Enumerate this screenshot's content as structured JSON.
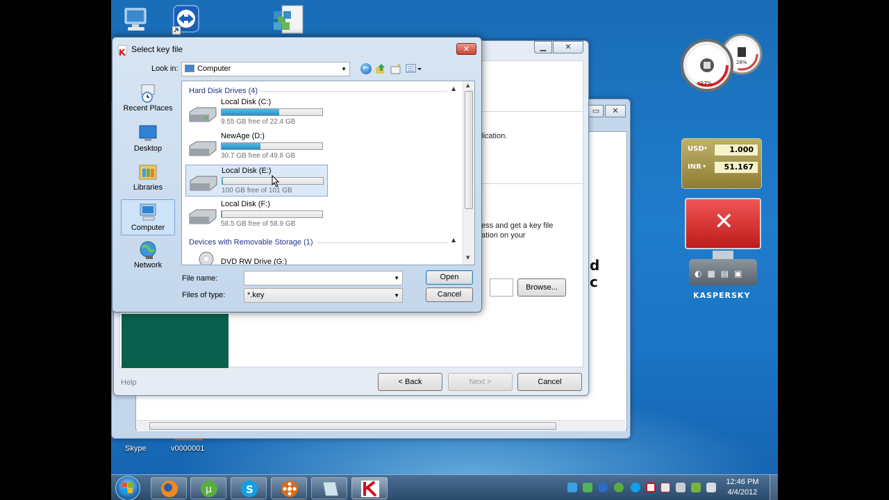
{
  "desktop": {
    "icons": [
      {
        "label": "Skype",
        "name": "skype"
      },
      {
        "label": "v0000001",
        "name": "v0000001"
      }
    ]
  },
  "gadgets": {
    "cpu_percent": "27%",
    "mem_percent": "28%",
    "currency": {
      "usd_label": "USD",
      "usd_value": "1.000",
      "inr_label": "INR",
      "inr_value": "51.167"
    },
    "kaspersky_brand": "KASPERSKY"
  },
  "wizard": {
    "text_fragment_1": "lication.",
    "text_fragment_2": "ess and get a key file",
    "text_fragment_3": "ation on your",
    "heading_fragment": "d c",
    "browse_label": "Browse...",
    "help_label": "Help",
    "back_label": "< Back",
    "next_label": "Next >",
    "cancel_label": "Cancel"
  },
  "dialog": {
    "title": "Select key file",
    "look_in_label": "Look in:",
    "look_in_value": "Computer",
    "places": [
      {
        "label": "Recent Places"
      },
      {
        "label": "Desktop"
      },
      {
        "label": "Libraries"
      },
      {
        "label": "Computer"
      },
      {
        "label": "Network"
      }
    ],
    "groups": {
      "hdd": "Hard Disk Drives (4)",
      "removable": "Devices with Removable Storage (1)"
    },
    "drives": [
      {
        "name": "Local Disk (C:)",
        "free": "9.55 GB free of 22.4 GB",
        "used_fraction": 0.574
      },
      {
        "name": "NewAge (D:)",
        "free": "30.7 GB free of 49.8 GB",
        "used_fraction": 0.384
      },
      {
        "name": "Local Disk (E:)",
        "free": "100 GB free of 101 GB",
        "used_fraction": 0.01
      },
      {
        "name": "Local Disk (F:)",
        "free": "58.5 GB free of 58.9 GB",
        "used_fraction": 0.007
      }
    ],
    "removable_item": "DVD RW Drive (G:)",
    "file_name_label": "File name:",
    "file_name_value": "",
    "file_type_label": "Files of type:",
    "file_type_value": "*.key",
    "open_label": "Open",
    "cancel_label": "Cancel"
  },
  "clock": {
    "time": "12:46 PM",
    "date": "4/4/2012"
  }
}
